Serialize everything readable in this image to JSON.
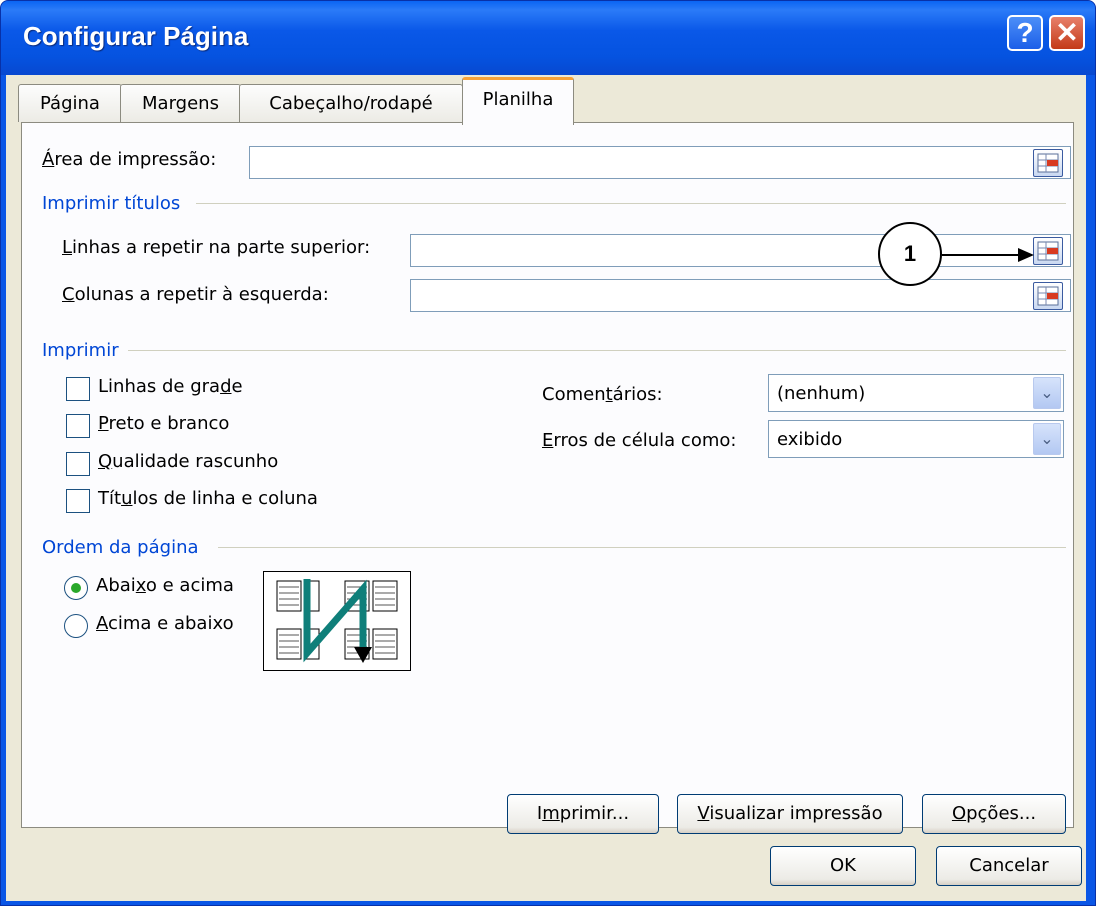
{
  "window": {
    "title": "Configurar Página",
    "help_glyph": "?",
    "close_glyph": "✕"
  },
  "tabs": [
    {
      "label": "Página",
      "active": false
    },
    {
      "label": "Margens",
      "active": false
    },
    {
      "label": "Cabeçalho/rodapé",
      "active": false
    },
    {
      "label": "Planilha",
      "active": true
    }
  ],
  "print_area": {
    "label_u": "Á",
    "label_rest": "rea de impressão:",
    "value": ""
  },
  "print_titles": {
    "group_label": "Imprimir títulos",
    "rows": {
      "label_u": "L",
      "label_rest": "inhas a repetir na parte superior:",
      "value": ""
    },
    "cols": {
      "label_u": "C",
      "label_rest": "olunas a repetir à esquerda:",
      "value": ""
    }
  },
  "callout": {
    "number": "1"
  },
  "print": {
    "group_label": "Imprimir",
    "options": [
      {
        "pre": "Linhas de gra",
        "u": "d",
        "post": "e",
        "checked": false
      },
      {
        "pre": "",
        "u": "P",
        "post": "reto e branco",
        "checked": false
      },
      {
        "pre": "",
        "u": "Q",
        "post": "ualidade rascunho",
        "checked": false
      },
      {
        "pre": "Tít",
        "u": "u",
        "post": "los de linha e coluna",
        "checked": false
      }
    ],
    "comments": {
      "pre": "Comen",
      "u": "t",
      "post": "ários:",
      "value": "(nenhum)"
    },
    "errors": {
      "pre": "",
      "u": "E",
      "post": "rros de célula como:",
      "value": "exibido"
    }
  },
  "page_order": {
    "group_label": "Ordem da página",
    "options": [
      {
        "pre": "Abai",
        "u": "x",
        "post": "o e acima",
        "selected": true
      },
      {
        "pre": "",
        "u": "A",
        "post": "cima e abaixo",
        "selected": false
      }
    ]
  },
  "buttons": {
    "print": {
      "pre": "I",
      "u": "m",
      "post": "primir..."
    },
    "preview": {
      "pre": "",
      "u": "V",
      "post": "isualizar impressão"
    },
    "options": {
      "pre": "",
      "u": "O",
      "post": "pções..."
    },
    "ok": "OK",
    "cancel": "Cancelar"
  },
  "colors": {
    "title_bar": "#0a56e6",
    "dialog_face": "#ece9d8",
    "group_label": "#0046d5",
    "active_tab_accent": "#f7a23a",
    "order_arrow": "#0f7f7a"
  },
  "icons": {
    "range_select": "range-select-icon",
    "dropdown": "chevron-down-icon",
    "page_order": "page-order-diagram-icon"
  }
}
